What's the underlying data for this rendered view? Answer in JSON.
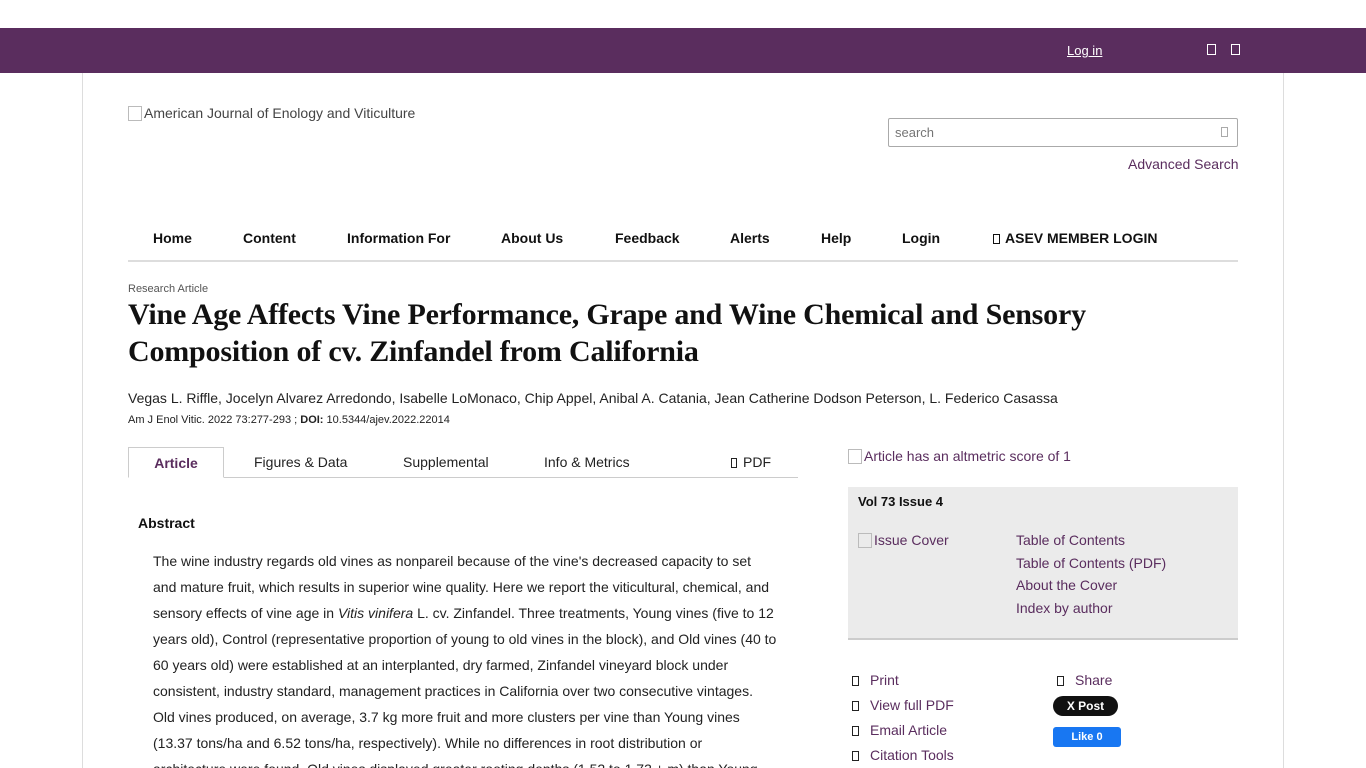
{
  "topbar": {
    "login_label": "Log in",
    "icons": [
      "user-icon",
      "cart-icon"
    ]
  },
  "header": {
    "logo_alt": "American Journal of Enology and Viticulture",
    "search_placeholder": "search",
    "advanced_search": "Advanced Search"
  },
  "nav": {
    "items": [
      "Home",
      "Content",
      "Information For",
      "About Us",
      "Feedback",
      "Alerts",
      "Help",
      "Login",
      "ASEV MEMBER LOGIN"
    ]
  },
  "article": {
    "kicker": "Research Article",
    "title": "Vine Age Affects Vine Performance, Grape and Wine Chemical and Sensory Composition of cv. Zinfandel from California",
    "authors": "Vegas L. Riffle, Jocelyn Alvarez Arredondo, Isabelle LoMonaco, Chip Appel, Anibal A. Catania, Jean Catherine Dodson Peterson, L. Federico Casassa",
    "citation": "Am J Enol Vitic. 2022 73:277-293 ; ",
    "doi_label": "DOI:",
    "doi": " 10.5344/ajev.2022.22014"
  },
  "tabs": [
    "Article",
    "Figures & Data",
    "Supplemental",
    "Info & Metrics",
    "PDF"
  ],
  "abstract": {
    "heading": "Abstract",
    "text_before_italic": "The wine industry regards old vines as nonpareil because of the vine's decreased capacity to set and mature fruit, which results in superior wine quality. Here we report the viticultural, chemical, and sensory effects of vine age in ",
    "italic": "Vitis vinifera",
    "text_after_italic": " L. cv. Zinfandel. Three treatments, Young vines (five to 12 years old), Control (representative proportion of young to old vines in the block), and Old vines (40 to 60 years old) were established at an interplanted, dry farmed, Zinfandel vineyard block under consistent, industry standard, management practices in California over two consecutive vintages. Old vines produced, on average, 3.7 kg more fruit and more clusters per vine than Young vines (13.37 tons/ha and 6.52 tons/ha, respectively). While no differences in root distribution or architecture were found, Old vines displayed greater rooting depths (1.52 to 1.73 ± m) than Young"
  },
  "sidebar": {
    "altmetric_alt": "Article has an altmetric score of 1",
    "issue_title": "Vol 73 Issue 4",
    "issue_cover_alt": "Issue Cover",
    "issue_links": [
      "Table of Contents",
      "Table of Contents (PDF)",
      "About the Cover",
      "Index by author"
    ],
    "tools_left": [
      "Print",
      "View full PDF",
      "Email Article",
      "Citation Tools"
    ],
    "share_label": "Share",
    "x_post": "X Post",
    "fb_like": "Like 0"
  },
  "colors": {
    "brand_purple": "#5a2d5e",
    "issue_box_bg": "#ebebeb",
    "fb_blue": "#1877f2"
  }
}
